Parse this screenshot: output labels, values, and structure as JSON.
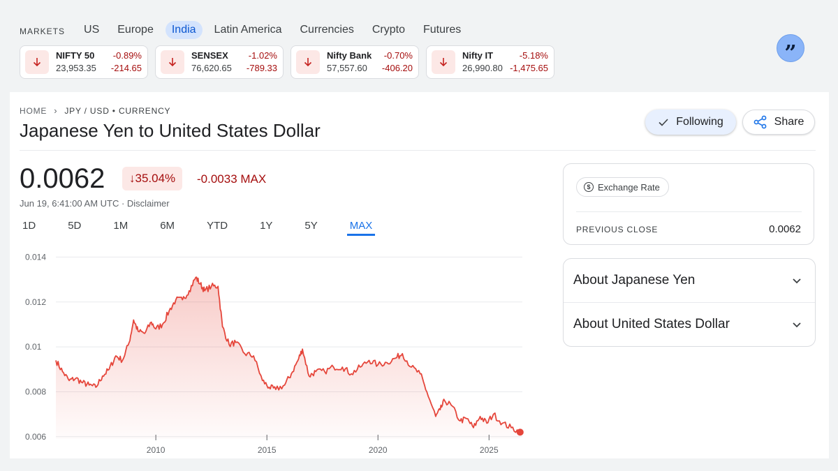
{
  "markets": {
    "label": "MARKETS",
    "tabs": [
      {
        "label": "US",
        "active": false
      },
      {
        "label": "Europe",
        "active": false
      },
      {
        "label": "India",
        "active": true
      },
      {
        "label": "Latin America",
        "active": false
      },
      {
        "label": "Currencies",
        "active": false
      },
      {
        "label": "Crypto",
        "active": false
      },
      {
        "label": "Futures",
        "active": false
      }
    ],
    "tickers": [
      {
        "name": "NIFTY 50",
        "pct": "-0.89%",
        "value": "23,953.35",
        "change": "-214.65"
      },
      {
        "name": "SENSEX",
        "pct": "-1.02%",
        "value": "76,620.65",
        "change": "-789.33"
      },
      {
        "name": "Nifty Bank",
        "pct": "-0.70%",
        "value": "57,557.60",
        "change": "-406.20"
      },
      {
        "name": "Nifty IT",
        "pct": "-5.18%",
        "value": "26,990.80",
        "change": "-1,475.65"
      }
    ]
  },
  "quote_icon": "quote-icon",
  "breadcrumb": {
    "home": "HOME",
    "current": "JPY / USD • CURRENCY"
  },
  "title": "Japanese Yen to United States Dollar",
  "actions": {
    "following": "Following",
    "share": "Share"
  },
  "quote": {
    "price": "0.0062",
    "pct_change": "35.04%",
    "change": "-0.0033 MAX",
    "timestamp": "Jun 19, 6:41:00 AM UTC · Disclaimer"
  },
  "ranges": [
    {
      "label": "1D",
      "active": false
    },
    {
      "label": "5D",
      "active": false
    },
    {
      "label": "1M",
      "active": false
    },
    {
      "label": "6M",
      "active": false
    },
    {
      "label": "YTD",
      "active": false
    },
    {
      "label": "1Y",
      "active": false
    },
    {
      "label": "5Y",
      "active": false
    },
    {
      "label": "MAX",
      "active": true
    }
  ],
  "colors": {
    "down": "#a50e0e",
    "accent": "#1a73e8",
    "line": "#e5463b"
  },
  "side": {
    "chip": "Exchange Rate",
    "previous_close_label": "PREVIOUS CLOSE",
    "previous_close_value": "0.0062",
    "about": [
      "About Japanese Yen",
      "About United States Dollar"
    ]
  },
  "chart_data": {
    "type": "area",
    "xlabel": "",
    "ylabel": "",
    "xlim": [
      2005.5,
      2026.5
    ],
    "ylim": [
      0.0059,
      0.0142
    ],
    "yticks": [
      0.014,
      0.012,
      0.01,
      0.008,
      0.006
    ],
    "ytick_labels": [
      "0.014",
      "0.012",
      "0.01",
      "0.008",
      "0.006"
    ],
    "xticks": [
      2010,
      2015,
      2020,
      2025
    ],
    "xtick_labels": [
      "2010",
      "2015",
      "2020",
      "2025"
    ],
    "grid": true,
    "x": [
      2005.5,
      2005.8,
      2006.1,
      2006.4,
      2006.7,
      2007.0,
      2007.3,
      2007.6,
      2007.9,
      2008.2,
      2008.5,
      2008.8,
      2009.0,
      2009.2,
      2009.5,
      2009.8,
      2010.0,
      2010.3,
      2010.6,
      2010.9,
      2011.2,
      2011.5,
      2011.8,
      2012.0,
      2012.2,
      2012.5,
      2012.8,
      2013.0,
      2013.3,
      2013.6,
      2014.0,
      2014.4,
      2014.8,
      2015.1,
      2015.4,
      2015.8,
      2016.1,
      2016.4,
      2016.6,
      2016.9,
      2017.2,
      2017.6,
      2018.0,
      2018.4,
      2018.8,
      2019.2,
      2019.6,
      2020.0,
      2020.4,
      2020.8,
      2021.1,
      2021.5,
      2021.9,
      2022.2,
      2022.6,
      2022.8,
      2023.0,
      2023.3,
      2023.7,
      2024.0,
      2024.3,
      2024.6,
      2024.9,
      2025.2,
      2025.6,
      2026.0,
      2026.4
    ],
    "values": [
      0.0094,
      0.0089,
      0.0085,
      0.0086,
      0.0084,
      0.0083,
      0.0082,
      0.0087,
      0.009,
      0.0096,
      0.0094,
      0.0102,
      0.0112,
      0.0107,
      0.0106,
      0.0111,
      0.0108,
      0.011,
      0.0116,
      0.0121,
      0.0121,
      0.0125,
      0.0131,
      0.0128,
      0.0125,
      0.0127,
      0.0127,
      0.0109,
      0.0101,
      0.0102,
      0.0097,
      0.0096,
      0.0085,
      0.0082,
      0.0081,
      0.0083,
      0.0088,
      0.0094,
      0.0099,
      0.0087,
      0.0089,
      0.0089,
      0.0091,
      0.0091,
      0.0088,
      0.0091,
      0.0094,
      0.0092,
      0.0093,
      0.0095,
      0.0097,
      0.0091,
      0.0088,
      0.008,
      0.0069,
      0.0072,
      0.0076,
      0.0074,
      0.0067,
      0.0068,
      0.0064,
      0.0069,
      0.0066,
      0.007,
      0.0066,
      0.0064,
      0.0062
    ]
  }
}
